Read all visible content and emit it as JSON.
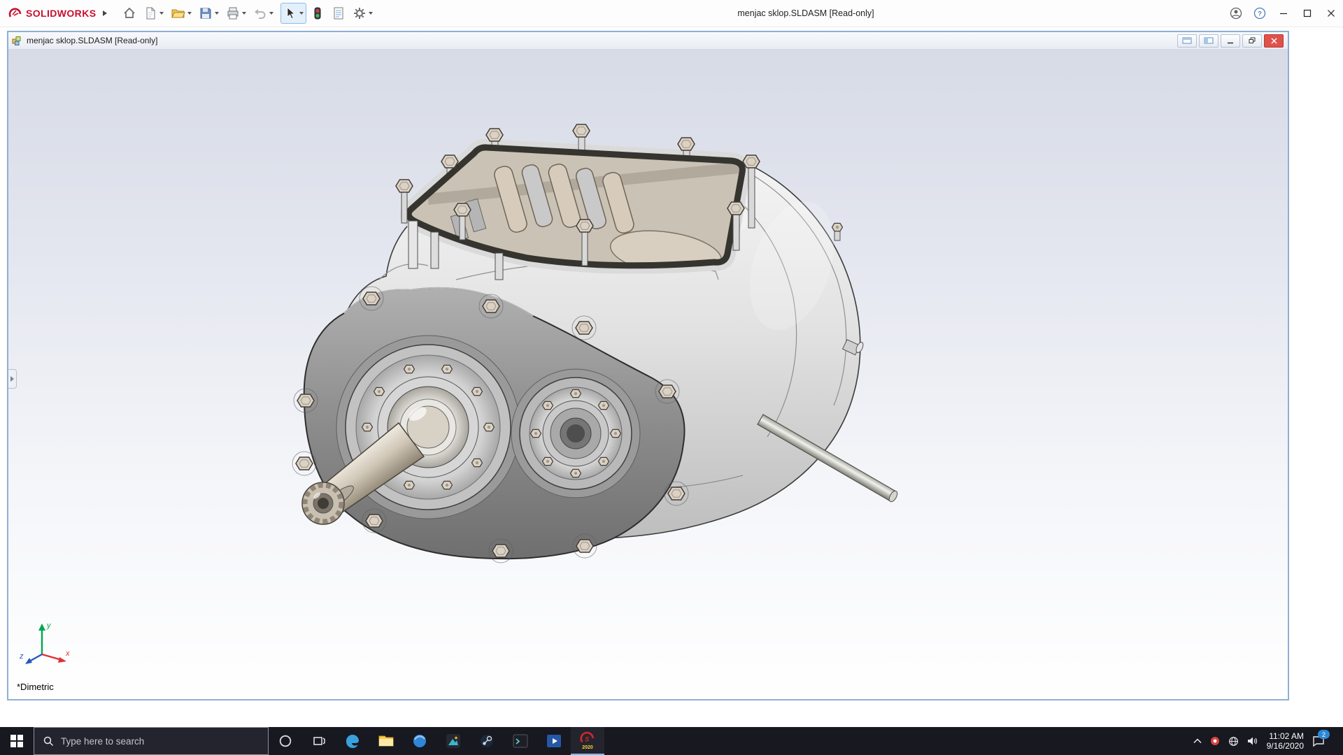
{
  "app": {
    "brand": "SOLIDWORKS",
    "window_title": "menjac sklop.SLDASM [Read-only]"
  },
  "toolbar": {
    "icon_names": [
      "home-icon",
      "new-document-icon",
      "open-folder-icon",
      "save-icon",
      "print-icon",
      "undo-icon",
      "select-cursor-icon",
      "rebuild-traffic-light-icon",
      "file-properties-icon",
      "options-gear-icon"
    ],
    "help_glyph": "?"
  },
  "document_window": {
    "title": "menjac sklop.SLDASM [Read-only]"
  },
  "viewport": {
    "orientation": "*Dimetric",
    "triad": {
      "x": "x",
      "y": "y",
      "z": "z"
    }
  },
  "taskbar": {
    "search_placeholder": "Type here to search",
    "pinned_app_icons": [
      "edge-icon",
      "file-explorer-icon",
      "browser-icon",
      "photos-icon",
      "steam-icon",
      "terminal-icon",
      "movies-icon",
      "solidworks-icon"
    ],
    "solidworks_glyph": "S",
    "solidworks_year": "2020",
    "tray": {
      "time": "11:02 AM",
      "date": "9/16/2020",
      "notification_count": "2"
    }
  },
  "colors": {
    "brand_red": "#c8102e",
    "taskbar_bg": "#171820",
    "close_red": "#e0514c",
    "viewport_gradient_top": "#d7dbe6",
    "viewport_gradient_bottom": "#ffffff"
  }
}
